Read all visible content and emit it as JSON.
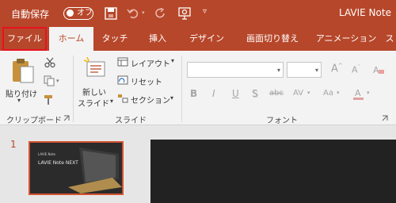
{
  "titlebar": {
    "autosave_label": "自動保存",
    "autosave_state": "オフ",
    "document_title": "LAVIE Note"
  },
  "tabs": [
    {
      "label": "ファイル"
    },
    {
      "label": "ホーム"
    },
    {
      "label": "タッチ"
    },
    {
      "label": "挿入"
    },
    {
      "label": "デザイン"
    },
    {
      "label": "画面切り替え"
    },
    {
      "label": "アニメーション"
    },
    {
      "label": "ス"
    }
  ],
  "ribbon": {
    "clipboard": {
      "paste_label": "貼り付け",
      "group_label": "クリップボード"
    },
    "slides": {
      "new_slide_label_1": "新しい",
      "new_slide_label_2": "スライド",
      "layout_label": "レイアウト",
      "reset_label": "リセット",
      "section_label": "セクション",
      "group_label": "スライド"
    },
    "font": {
      "font_name_value": "",
      "font_size_value": "",
      "bold": "B",
      "italic": "I",
      "underline": "U",
      "shadow": "S",
      "strike": "abc",
      "spacing": "AV",
      "case": "Aa",
      "group_label": "フォント"
    }
  },
  "slides_pane": {
    "slide_number": "1",
    "thumb_text_small": "LAVIE Note",
    "thumb_title": "LAVIE Note NEXT"
  }
}
